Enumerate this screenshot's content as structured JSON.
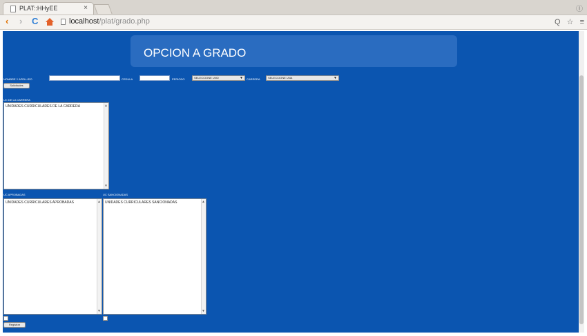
{
  "browser": {
    "tab_title": "PLAT::HHyEE",
    "tab_close": "×",
    "url_host": "localhost",
    "url_path": "/plat/grado.php",
    "back": "‹",
    "forward": "›",
    "reload": "C",
    "zoom": "Q",
    "star": "☆",
    "menu": "≡",
    "window_control": "Ⓘ"
  },
  "page": {
    "title": "OPCION A GRADO",
    "form": {
      "nombre_label": "NOMBRE Y APELLIDO",
      "nombre_value": "",
      "cedula_label": "CEDULA",
      "cedula_value": "",
      "periodo_label": "PERIODO",
      "periodo_selected": "SELECCIONE UNO",
      "carrera_label": "CARRERA",
      "carrera_selected": "SELECCIONE UNA",
      "submit_label": "Solicitudes"
    },
    "uc_carrera": {
      "label": "UC DE LA CARRERA",
      "option": "UNIDADES CURRICULARES DE LA CARRERA"
    },
    "uc_aprobadas": {
      "label": "UC APROBADAS",
      "option": "UNIDADES CURRICULARES APROBADAS"
    },
    "uc_sancionadas": {
      "label": "UC SANCIONADAS",
      "option": "UNIDADES CURRICULARES SANCIONADAS"
    },
    "register_label": "Registrar"
  },
  "colors": {
    "page_background": "#0b55b0",
    "banner": "#2a6cc0"
  }
}
